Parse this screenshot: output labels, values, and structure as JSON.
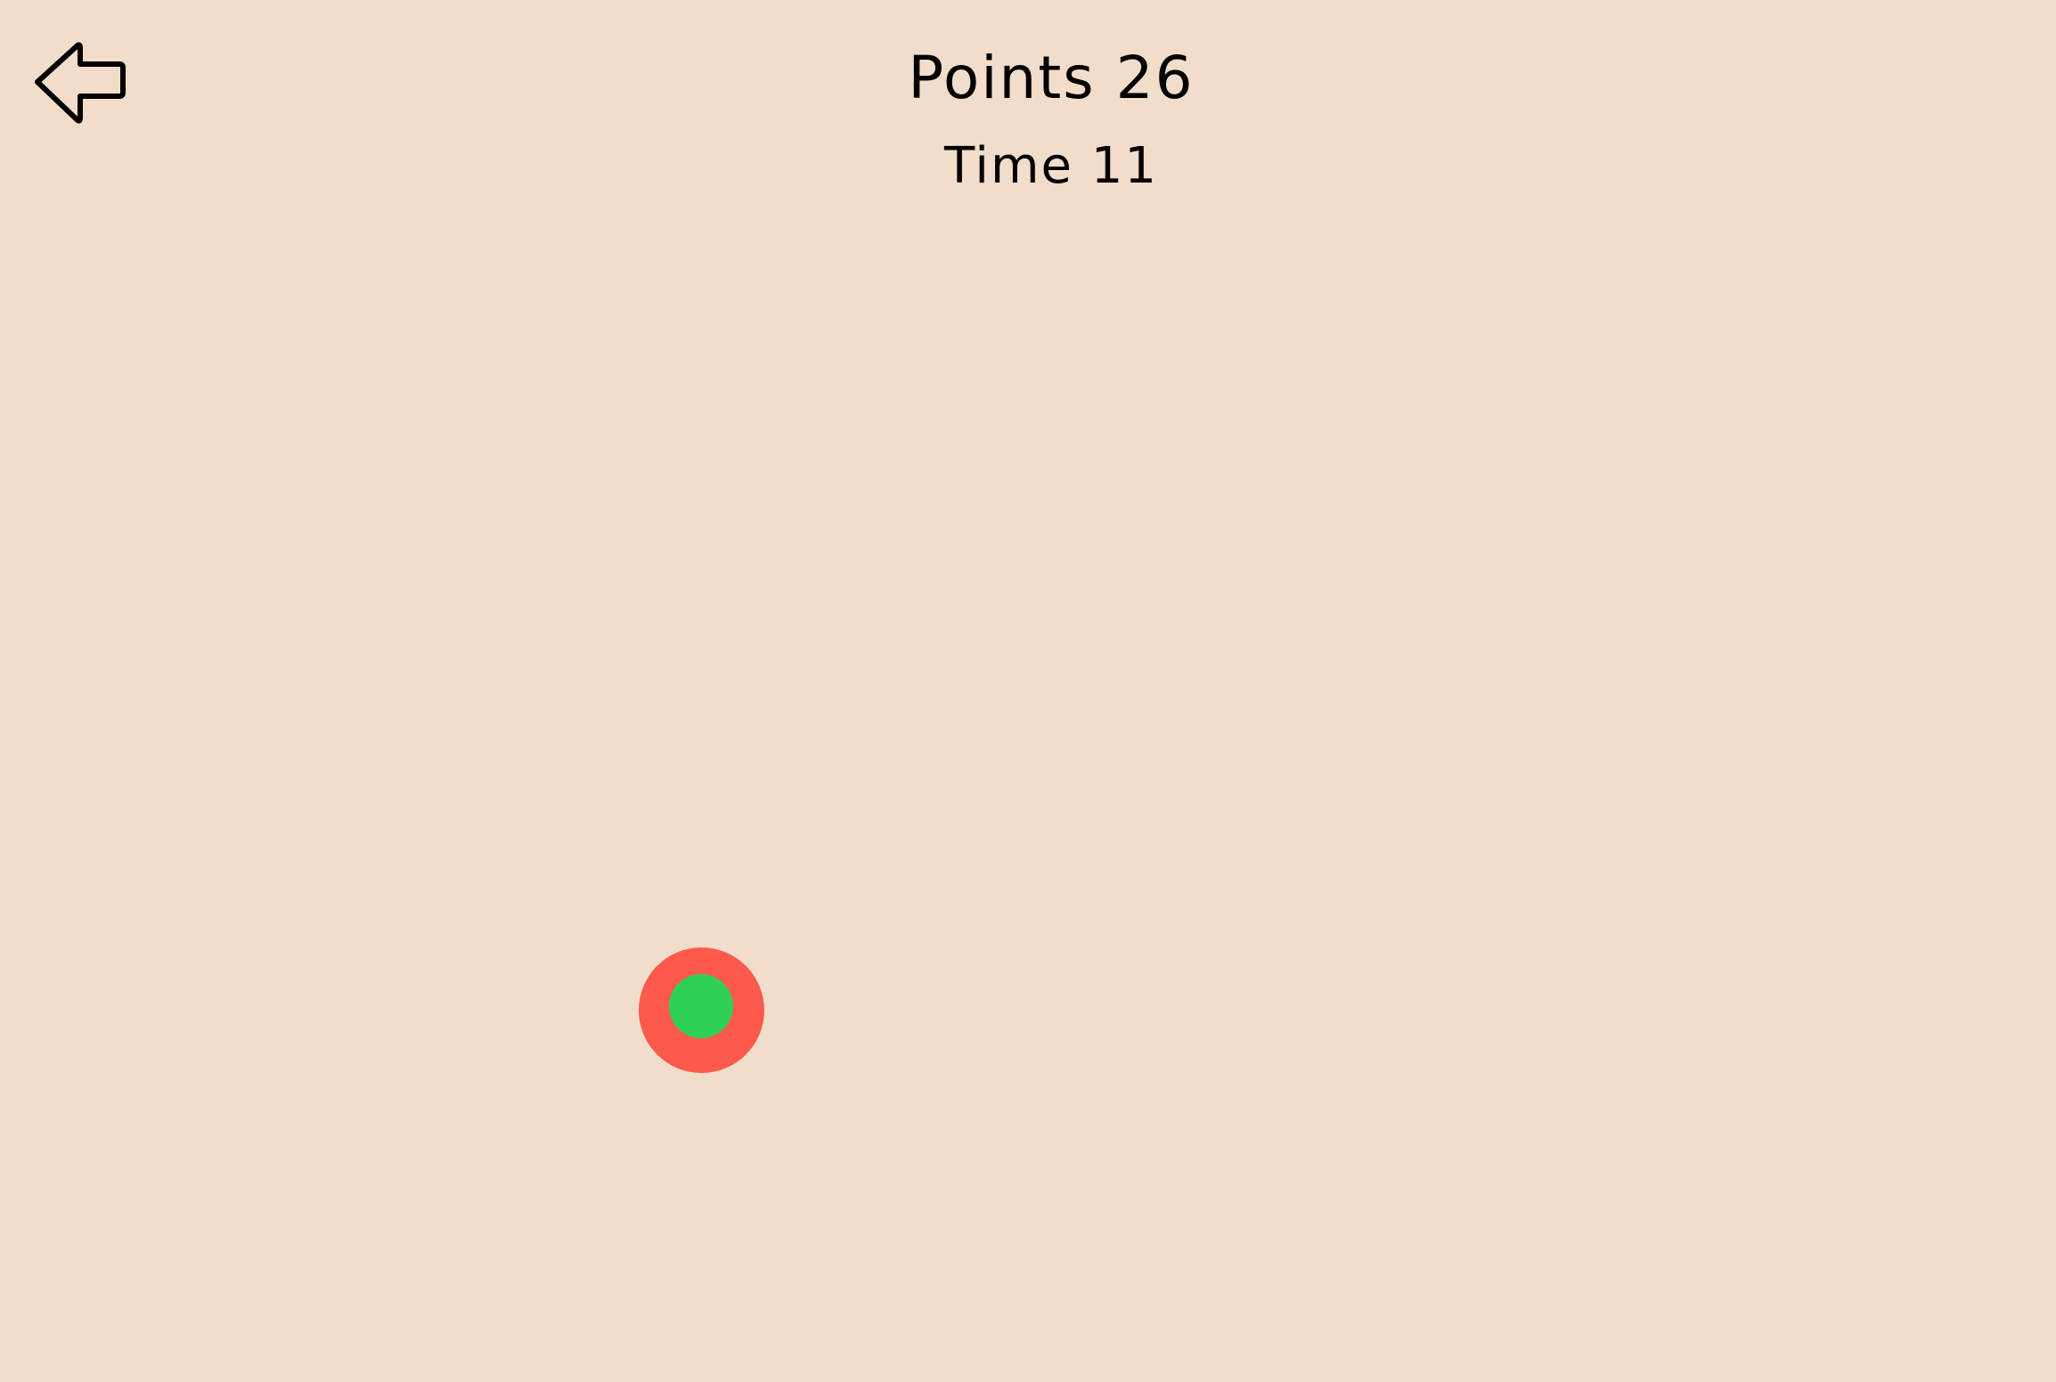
{
  "hud": {
    "points_label": "Points 26",
    "time_label": "Time 11"
  },
  "controls": {
    "back_icon": "left-arrow-outline-icon"
  },
  "target": {
    "outer_color": "#FE5A4C",
    "inner_color": "#2ED158"
  },
  "colors": {
    "background": "#F1DDCA",
    "text": "#000000"
  }
}
